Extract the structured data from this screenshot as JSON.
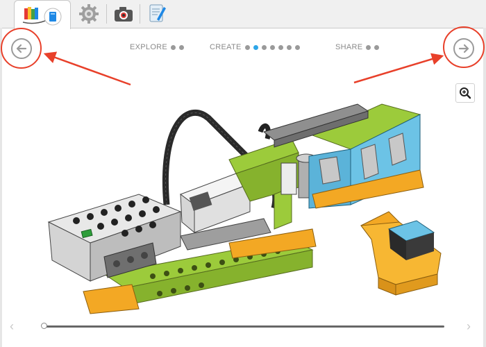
{
  "tabs": [
    {
      "name": "tab-projects",
      "icon": "book-stack-icon",
      "active": true
    },
    {
      "name": "tab-gear",
      "icon": "gear-icon",
      "active": false
    },
    {
      "name": "tab-camera",
      "icon": "camera-icon",
      "active": false
    },
    {
      "name": "tab-document",
      "icon": "document-icon",
      "active": false
    }
  ],
  "steps": {
    "explore": {
      "label": "EXPLORE",
      "dots": 2,
      "active_index": -1
    },
    "create": {
      "label": "CREATE",
      "dots": 7,
      "active_index": 1
    },
    "share": {
      "label": "SHARE",
      "dots": 2,
      "active_index": -1
    }
  },
  "colors": {
    "accent_dot": "#2ea6e8",
    "annotation": "#e8402a",
    "lego_green": "#9ccb3b",
    "lego_blue": "#5bb3d9",
    "lego_orange": "#f3a824"
  },
  "scrubber": {
    "progress": 0.0
  }
}
